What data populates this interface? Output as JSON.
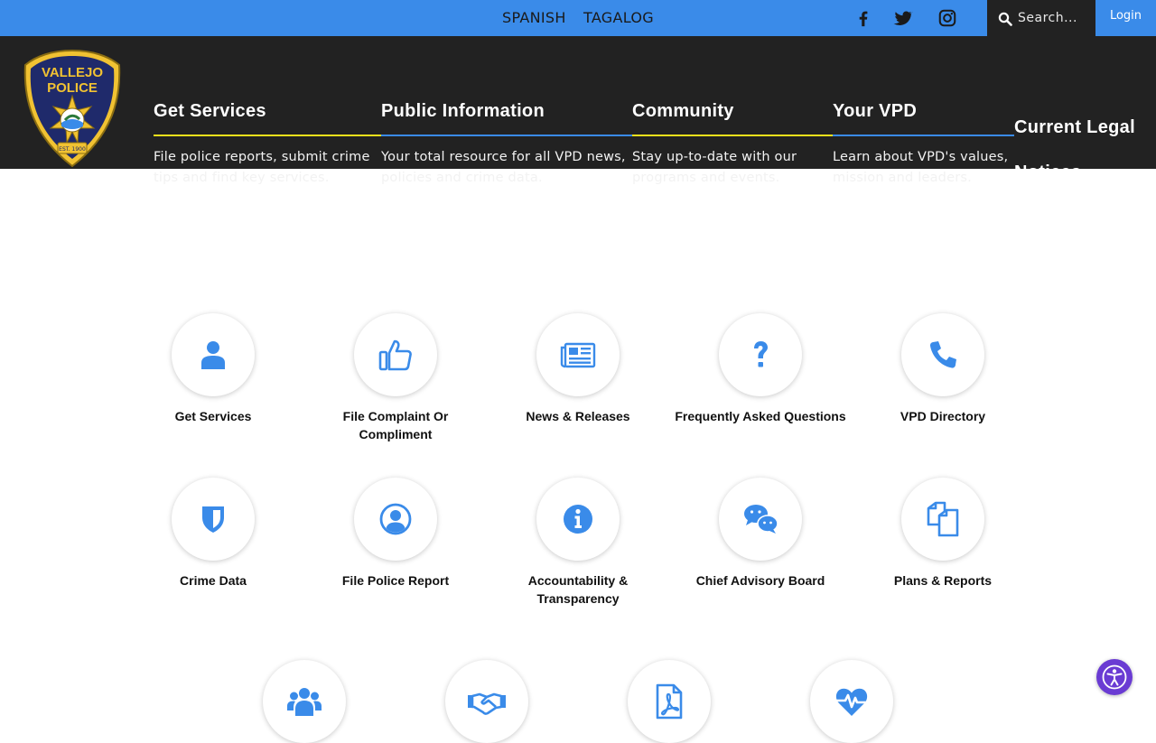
{
  "topbar": {
    "languages": [
      "SPANISH",
      "TAGALOG"
    ],
    "social": [
      "facebook-icon",
      "twitter-icon",
      "instagram-icon"
    ],
    "search_placeholder": "Search...",
    "login_label": "Login",
    "accent_color": "#3a8be9"
  },
  "logo": {
    "text_top": "VALLEJO",
    "text_bottom": "POLICE",
    "est": "EST. 1900"
  },
  "nav": {
    "items": [
      {
        "title": "Get Services",
        "desc": "File police reports, submit crime tips and find key services.",
        "rule_color": "#f5e11b"
      },
      {
        "title": "Public Information",
        "desc": "Your total resource for all VPD news, policies and crime data.",
        "rule_color": "#3a8be9"
      },
      {
        "title": "Community",
        "desc": "Stay up-to-date with our programs and events.",
        "rule_color": "#f5e11b"
      },
      {
        "title": "Your VPD",
        "desc": "Learn about VPD's values, mission and leaders.",
        "rule_color": "#3a8be9"
      }
    ],
    "extra": [
      "Current Legal",
      "Notices"
    ]
  },
  "tiles": [
    {
      "label": "Get Services",
      "icon": "user-icon"
    },
    {
      "label": "File Complaint Or Compliment",
      "icon": "thumbs-up-icon"
    },
    {
      "label": "News & Releases",
      "icon": "newspaper-icon"
    },
    {
      "label": "Frequently Asked Questions",
      "icon": "question-icon"
    },
    {
      "label": "VPD Directory",
      "icon": "phone-icon"
    },
    {
      "label": "Crime Data",
      "icon": "shield-icon"
    },
    {
      "label": "File Police Report",
      "icon": "user-circle-icon"
    },
    {
      "label": "Accountability & Transparency",
      "icon": "info-icon"
    },
    {
      "label": "Chief Advisory Board",
      "icon": "chat-icon"
    },
    {
      "label": "Plans & Reports",
      "icon": "documents-icon"
    },
    {
      "label": "",
      "icon": "users-icon"
    },
    {
      "label": "",
      "icon": "handshake-icon"
    },
    {
      "label": "",
      "icon": "pdf-icon"
    },
    {
      "label": "",
      "icon": "heartbeat-icon"
    }
  ],
  "icon_color": "#3a8be9",
  "accessibility": {
    "icon": "accessibility-icon",
    "color": "#6a3bd3"
  }
}
